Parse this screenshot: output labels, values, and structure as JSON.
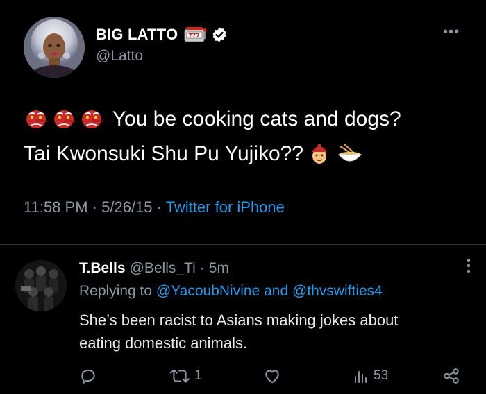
{
  "main_tweet": {
    "display_name": "BIG LATTO",
    "handle": "@Latto",
    "more_label": "•••",
    "text_line1": "You be cooking cats and dogs?",
    "text_line2": "Tai Kwonsuki Shu Pu Yujiko??",
    "time": "11:58 PM",
    "date": "5/26/15",
    "separator": "·",
    "source": "Twitter for iPhone",
    "icons": [
      "slot-machine-emoji",
      "verified-badge-icon",
      "tengu-mask-emoji",
      "chinese-man-cap-emoji",
      "noodle-bowl-emoji"
    ]
  },
  "reply_tweet": {
    "display_name": "T.Bells",
    "handle": "@Bells_Ti",
    "separator": "·",
    "time": "5m",
    "replying_prefix": "Replying to",
    "mention1": "@YacoubNivine",
    "replying_and": "and",
    "mention2": "@thvswifties4",
    "text_line1": "She’s been racist to Asians making jokes about",
    "text_line2": "eating domestic animals.",
    "actions": {
      "reply_count": "",
      "retweet_count": "1",
      "like_count": "",
      "views_count": "53"
    }
  },
  "colors": {
    "background": "#000000",
    "primary_text": "#ffffff",
    "secondary_text": "#8b98a5",
    "link": "#1d9bf0",
    "divider": "#2f3336"
  }
}
